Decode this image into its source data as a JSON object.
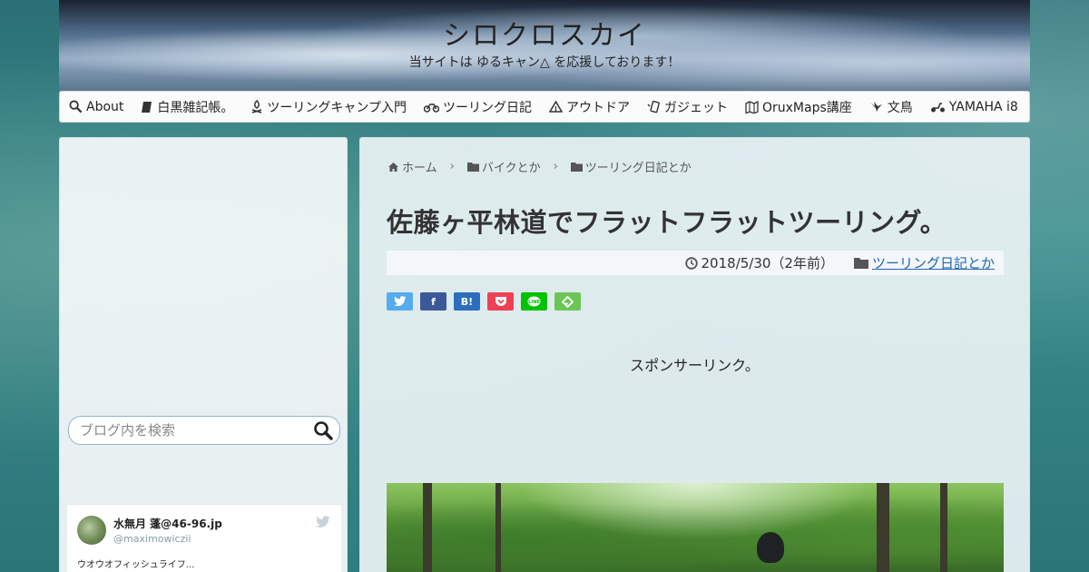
{
  "header": {
    "site_title": "シロクロスカイ",
    "site_description": "当サイトは ゆるキャン△ を応援しております！"
  },
  "nav": {
    "items": [
      {
        "icon": "search-icon",
        "label": "About"
      },
      {
        "icon": "notebook-icon",
        "label": "白黒雑記帳。"
      },
      {
        "icon": "campfire-icon",
        "label": "ツーリングキャンプ入門"
      },
      {
        "icon": "motorcycle-icon",
        "label": "ツーリング日記"
      },
      {
        "icon": "tent-icon",
        "label": "アウトドア"
      },
      {
        "icon": "gadget-icon",
        "label": "ガジェット"
      },
      {
        "icon": "map-icon",
        "label": "OruxMaps講座"
      },
      {
        "icon": "bird-icon",
        "label": "文鳥"
      },
      {
        "icon": "scooter-icon",
        "label": "YAMAHA i8"
      }
    ]
  },
  "sidebar": {
    "search": {
      "placeholder": "ブログ内を検索"
    },
    "twitter": {
      "name": "水無月 蓬@46-96.jp",
      "handle": "@maximowiczii",
      "text": "ウオウオフィッシュライフ..."
    }
  },
  "main": {
    "breadcrumb": [
      {
        "icon": "home-icon",
        "label": "ホーム"
      },
      {
        "icon": "folder-icon",
        "label": "バイクとか"
      },
      {
        "icon": "folder-icon",
        "label": "ツーリング日記とか"
      }
    ],
    "title": "佐藤ヶ平林道でフラットフラットツーリング。",
    "meta": {
      "date": "2018/5/30（2年前）",
      "category": "ツーリング日記とか"
    },
    "share": [
      {
        "name": "twitter",
        "label": "",
        "color": "#55acee"
      },
      {
        "name": "facebook",
        "label": "f",
        "color": "#3b5998"
      },
      {
        "name": "hatena",
        "label": "B!",
        "color": "#2c6ebd"
      },
      {
        "name": "pocket",
        "label": "",
        "color": "#ef4056"
      },
      {
        "name": "line",
        "label": "",
        "color": "#00c300"
      },
      {
        "name": "feedly",
        "label": "",
        "color": "#6cc655"
      }
    ],
    "sponsor_label": "スポンサーリンク。"
  }
}
